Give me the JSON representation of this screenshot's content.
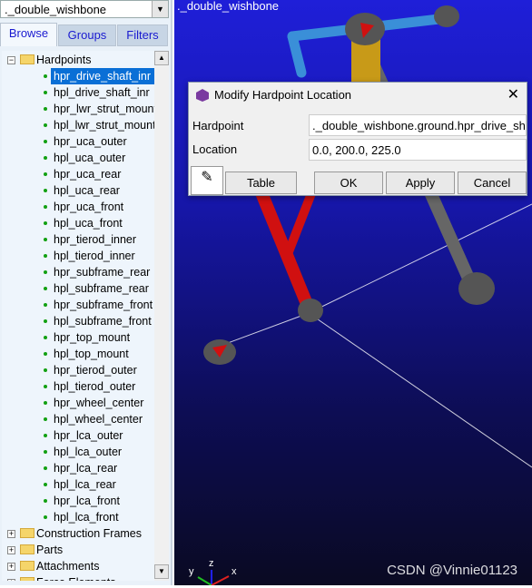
{
  "model_selector": {
    "value": "._double_wishbone"
  },
  "tabs": [
    {
      "label": "Browse",
      "active": true
    },
    {
      "label": "Groups"
    },
    {
      "label": "Filters"
    }
  ],
  "tree": {
    "hardpoints_label": "Hardpoints",
    "hardpoints": [
      "hpr_drive_shaft_inr",
      "hpl_drive_shaft_inr",
      "hpr_lwr_strut_mount",
      "hpl_lwr_strut_mount",
      "hpr_uca_outer",
      "hpl_uca_outer",
      "hpr_uca_rear",
      "hpl_uca_rear",
      "hpr_uca_front",
      "hpl_uca_front",
      "hpr_tierod_inner",
      "hpl_tierod_inner",
      "hpr_subframe_rear",
      "hpl_subframe_rear",
      "hpr_subframe_front",
      "hpl_subframe_front",
      "hpr_top_mount",
      "hpl_top_mount",
      "hpr_tierod_outer",
      "hpl_tierod_outer",
      "hpr_wheel_center",
      "hpl_wheel_center",
      "hpr_lca_outer",
      "hpl_lca_outer",
      "hpr_lca_rear",
      "hpl_lca_rear",
      "hpr_lca_front",
      "hpl_lca_front"
    ],
    "selected": "hpr_drive_shaft_inr",
    "folders": [
      "Construction Frames",
      "Parts",
      "Attachments",
      "Force Elements"
    ]
  },
  "viewport": {
    "model_name": "._double_wishbone",
    "axes": {
      "x": "x",
      "y": "y",
      "z": "z"
    },
    "watermark": "CSDN @Vinnie01123"
  },
  "dialog": {
    "title": "Modify Hardpoint Location",
    "hardpoint_label": "Hardpoint",
    "hardpoint_value": "._double_wishbone.ground.hpr_drive_shaft_inr",
    "location_label": "Location",
    "location_value": "0.0, 200.0, 225.0",
    "table": "Table",
    "ok": "OK",
    "apply": "Apply",
    "cancel": "Cancel"
  }
}
